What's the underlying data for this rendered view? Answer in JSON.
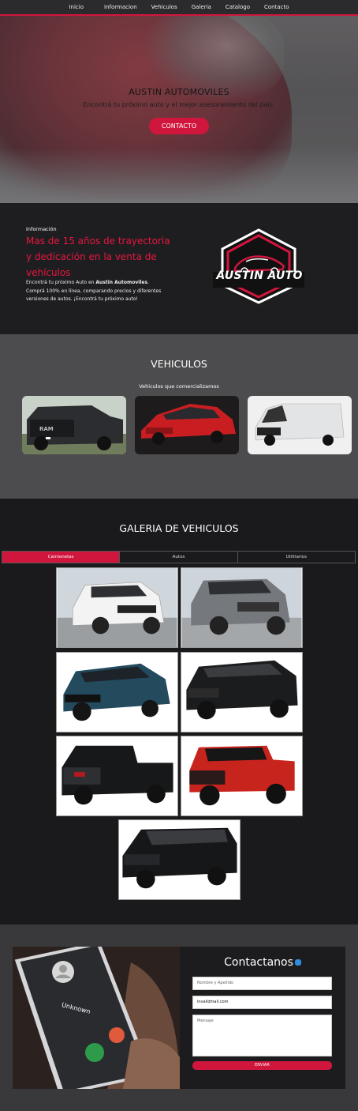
{
  "nav": {
    "items": [
      "Inicio",
      "Informacion",
      "Vehiculos",
      "Galeria",
      "Catalogo",
      "Contacto"
    ]
  },
  "hero": {
    "title": "AUSTIN AUTOMOVILES",
    "subtitle": "Encontrá tu próximo auto y el mejor asesoramiento del país.",
    "button": "CONTACTO"
  },
  "info": {
    "label": "Información",
    "title": "Mas de 15 años de trayectoria y dedicación en la venta de vehículos",
    "text_a": "Encontrá tu próximo Auto en ",
    "text_brand": "Austin Automoviles",
    "text_b": ". Comprá 100% en línea, comparando precios y diferentes versiones de autos. ¡Encontrá tu próximo auto!",
    "logo_text": "AUSTIN AUTO"
  },
  "vehiculos": {
    "title": "VEHICULOS",
    "subtitle": "Vehiculos que comercializamos",
    "cards": [
      "ram-truck-image",
      "red-sedan-image",
      "white-van-image"
    ]
  },
  "galeria": {
    "title": "GALERIA DE VEHICULOS",
    "tabs": [
      "Camionetas",
      "Autos",
      "Utilitarios"
    ],
    "active_tab": "Camionetas"
  },
  "contact": {
    "title": "Contactanos",
    "name_placeholder": "Nombre y Apellido",
    "email_value": "invalidmail.com",
    "message_placeholder": "Mensaje",
    "button": "ENVIAR",
    "phone_caller": "Unknown"
  },
  "colors": {
    "accent": "#d1163d",
    "dark": "#1c1c1e",
    "panel": "#4c4c4e"
  }
}
